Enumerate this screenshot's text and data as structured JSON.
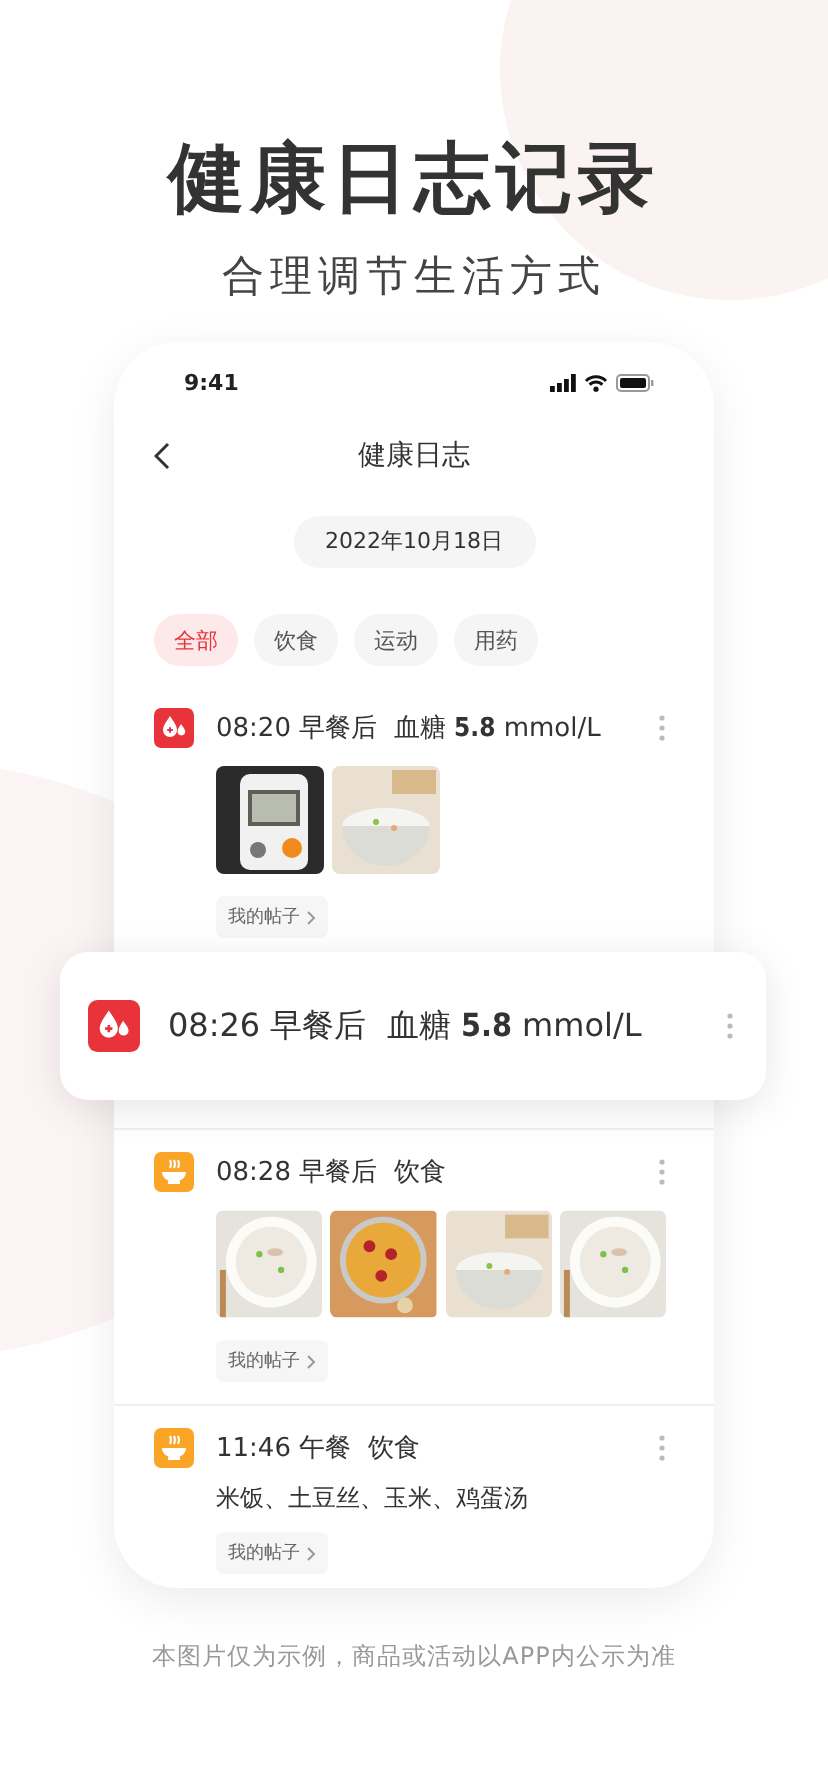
{
  "headline": "健康日志记录",
  "subheadline": "合理调节生活方式",
  "phone": {
    "status_bar": {
      "time": "9:41"
    },
    "nav": {
      "title": "健康日志"
    },
    "date": "2022年10月18日",
    "filters": [
      {
        "label": "全部",
        "selected": true
      },
      {
        "label": "饮食",
        "selected": false
      },
      {
        "label": "运动",
        "selected": false
      },
      {
        "label": "用药",
        "selected": false
      }
    ],
    "entries": [
      {
        "kind": "glucose",
        "title": "08:20 早餐后  血糖 **5.8** mmol/L",
        "post_link": "我的帖子"
      },
      {
        "kind": "diet",
        "title": "08:28 早餐后  饮食",
        "post_link": "我的帖子"
      },
      {
        "kind": "diet",
        "title": "11:46 午餐  饮食",
        "description": "米饭、土豆丝、玉米、鸡蛋汤",
        "post_link": "我的帖子"
      }
    ]
  },
  "floating_card": {
    "kind": "glucose",
    "title": "08:26 早餐后  血糖 **5.8** mmol/L"
  },
  "disclaimer": "本图片仅为示例，商品或活动以APP内公示为准"
}
